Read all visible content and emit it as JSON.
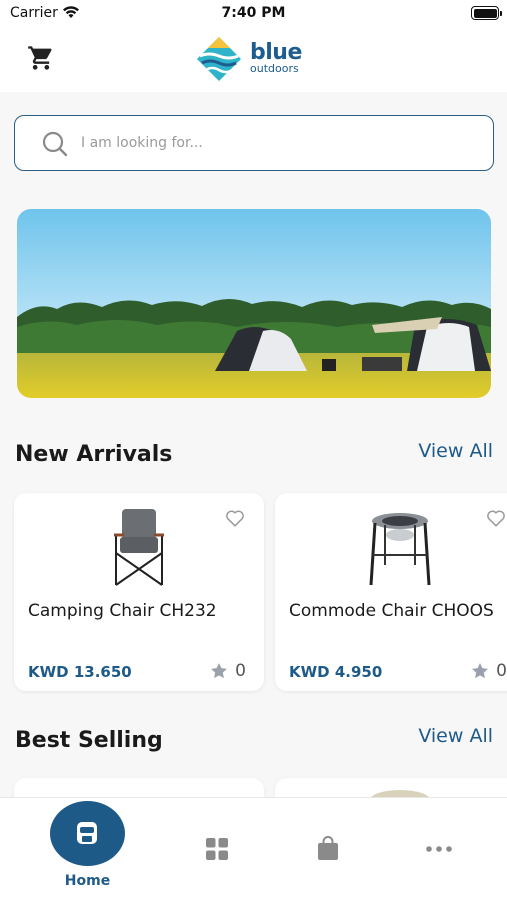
{
  "status_bar": {
    "carrier": "Carrier",
    "time": "7:40 PM"
  },
  "header": {
    "logo_word1": "blue",
    "logo_word2": "outdoors"
  },
  "search": {
    "placeholder": "I am looking for..."
  },
  "sections": {
    "new_arrivals": {
      "title": "New Arrivals",
      "view_all": "View All"
    },
    "best_selling": {
      "title": "Best Selling",
      "view_all": "View All"
    }
  },
  "products": [
    {
      "name": "Camping Chair CH232",
      "price": "KWD 13.650",
      "rating": "0"
    },
    {
      "name": "Commode Chair CHOOS",
      "price": "KWD 4.950",
      "rating": "0"
    }
  ],
  "tabbar": {
    "home_label": "Home"
  },
  "colors": {
    "brand": "#1e5a88",
    "accent_teal": "#2fb3c9",
    "accent_yellow": "#f3c43a"
  },
  "icons": [
    "cart-icon",
    "search-icon",
    "heart-icon",
    "star-icon",
    "grid-icon",
    "shopping-bag-icon",
    "more-icon",
    "home-icon",
    "wifi-icon",
    "battery-icon"
  ]
}
